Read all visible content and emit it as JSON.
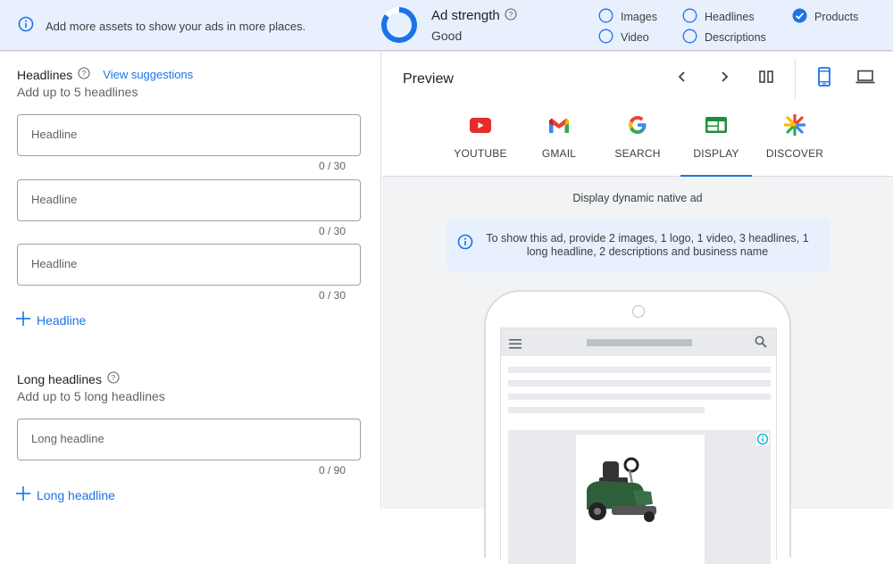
{
  "topbar": {
    "info_message": "Add more assets to show your ads in more places.",
    "ad_strength": {
      "title": "Ad strength",
      "value": "Good",
      "progress": 0.85,
      "color": "#1a73e8"
    },
    "checklist": [
      {
        "label": "Images",
        "checked": false
      },
      {
        "label": "Video",
        "checked": false
      },
      {
        "label": "Headlines",
        "checked": false
      },
      {
        "label": "Descriptions",
        "checked": false
      },
      {
        "label": "Products",
        "checked": true
      }
    ]
  },
  "headlines": {
    "title": "Headlines",
    "view_suggestions": "View suggestions",
    "subtitle": "Add up to 5 headlines",
    "fields": [
      {
        "placeholder": "Headline",
        "value": "",
        "counter": "0 / 30"
      },
      {
        "placeholder": "Headline",
        "value": "",
        "counter": "0 / 30"
      },
      {
        "placeholder": "Headline",
        "value": "",
        "counter": "0 / 30"
      }
    ],
    "add_label": "Headline"
  },
  "long_headlines": {
    "title": "Long headlines",
    "subtitle": "Add up to 5 long headlines",
    "fields": [
      {
        "placeholder": "Long headline",
        "value": "",
        "counter": "0 / 90"
      }
    ],
    "add_label": "Long headline"
  },
  "preview": {
    "title": "Preview",
    "tabs": [
      {
        "label": "YOUTUBE",
        "icon": "youtube-icon",
        "active": false
      },
      {
        "label": "GMAIL",
        "icon": "gmail-icon",
        "active": false
      },
      {
        "label": "SEARCH",
        "icon": "google-search-icon",
        "active": false
      },
      {
        "label": "DISPLAY",
        "icon": "display-icon",
        "active": true
      },
      {
        "label": "DISCOVER",
        "icon": "discover-icon",
        "active": false
      }
    ],
    "device": "mobile",
    "ad_type": "Display dynamic native ad",
    "notice": "To show this ad, provide 2 images, 1 logo, 1 video, 3 headlines, 1 long headline, 2 descriptions and business name",
    "accent_color": "#1a73e8"
  }
}
